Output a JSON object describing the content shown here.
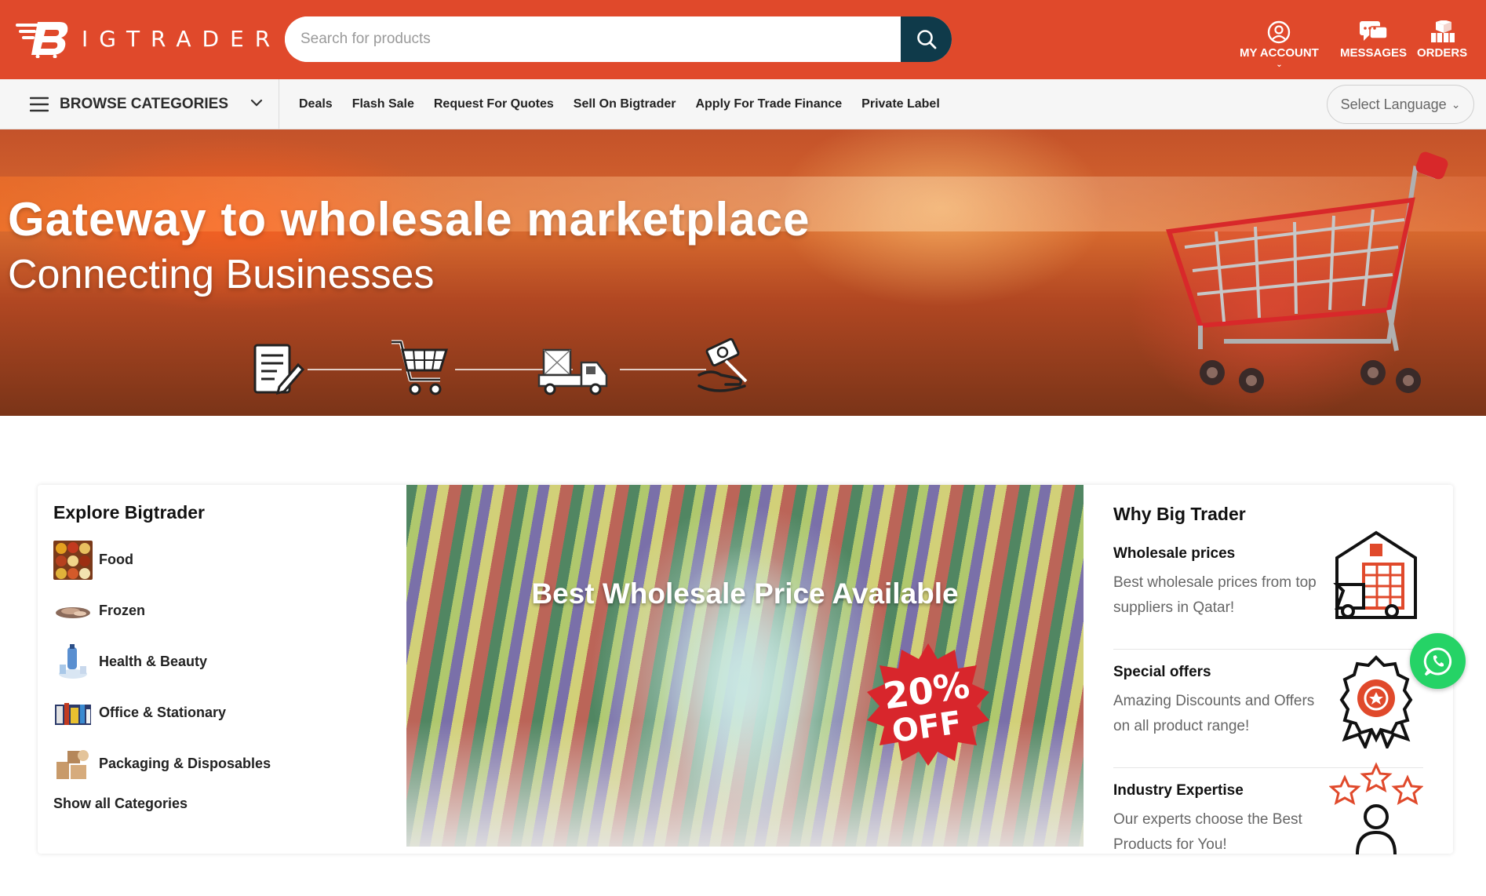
{
  "header": {
    "logo_text": "IGTRADER",
    "search_placeholder": "Search for products",
    "actions": [
      {
        "label": "MY ACCOUNT",
        "icon": "user-circle-icon"
      },
      {
        "label": "MESSAGES",
        "icon": "chat-bubbles-icon"
      },
      {
        "label": "ORDERS",
        "icon": "boxes-icon"
      }
    ],
    "brand_color": "#e0492b",
    "search_button_color": "#0f3a4a"
  },
  "nav": {
    "browse_label": "BROWSE CATEGORIES",
    "links": [
      "Deals",
      "Flash Sale",
      "Request For Quotes",
      "Sell On Bigtrader",
      "Apply For Trade Finance",
      "Private Label"
    ],
    "language_label": "Select Language"
  },
  "hero": {
    "title": "Gateway to wholesale marketplace",
    "subtitle": "Connecting Businesses",
    "steps": [
      "document-edit-icon",
      "shopping-cart-icon",
      "delivery-truck-icon",
      "money-hand-icon"
    ]
  },
  "explore": {
    "title": "Explore Bigtrader",
    "categories": [
      {
        "label": "Food",
        "thumb": "food-thumb"
      },
      {
        "label": "Frozen",
        "thumb": "frozen-thumb"
      },
      {
        "label": "Health & Beauty",
        "thumb": "health-thumb"
      },
      {
        "label": "Office & Stationary",
        "thumb": "office-thumb"
      },
      {
        "label": "Packaging & Disposables",
        "thumb": "packaging-thumb"
      }
    ],
    "show_all": "Show all Categories"
  },
  "promo": {
    "title": "Best Wholesale Price Available",
    "badge_line1": "20%",
    "badge_line2": "OFF"
  },
  "why": {
    "title": "Why Big Trader",
    "items": [
      {
        "heading": "Wholesale prices",
        "text": "Best wholesale prices from top suppliers in Qatar!",
        "icon": "warehouse-truck-icon"
      },
      {
        "heading": "Special offers",
        "text": "Amazing Discounts and Offers on all product range!",
        "icon": "award-badge-icon"
      },
      {
        "heading": "Industry Expertise",
        "text": "Our experts choose the Best Products for You!",
        "icon": "expert-stars-icon"
      }
    ]
  }
}
